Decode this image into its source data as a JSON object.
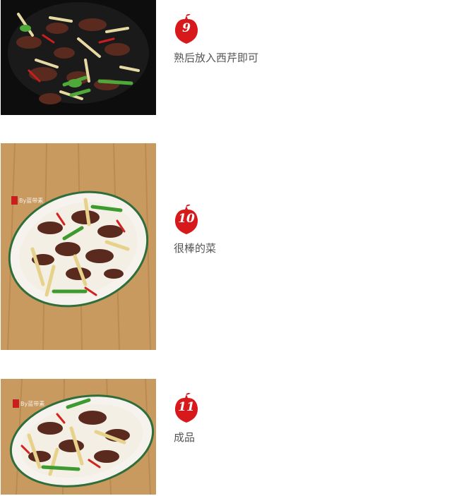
{
  "steps": [
    {
      "number": "9",
      "text": "熟后放入西芹即可",
      "image_caption": "stir-fry in wok"
    },
    {
      "number": "10",
      "text": "很棒的菜",
      "image_caption": "finished dish on plate",
      "watermark": "By蓝带素"
    },
    {
      "number": "11",
      "text": "成品",
      "image_caption": "finished dish close-up",
      "watermark": "By蓝带素"
    }
  ],
  "colors": {
    "badge_red": "#d8191c",
    "text_gray": "#555555"
  }
}
